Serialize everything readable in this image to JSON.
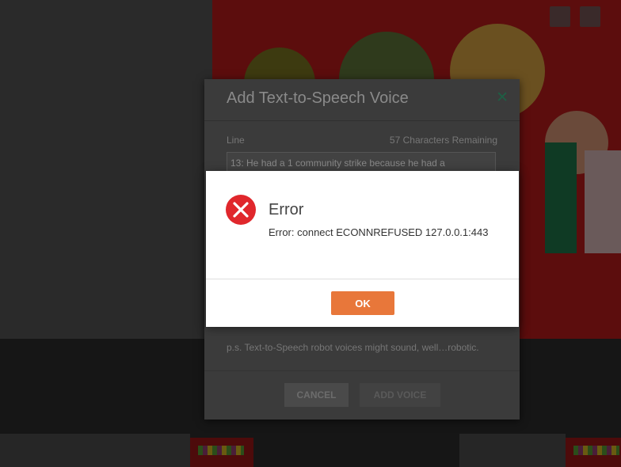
{
  "tts_dialog": {
    "title": "Add Text-to-Speech Voice",
    "close_icon": "close-icon",
    "line_label": "Line",
    "chars_remaining": "57 Characters Remaining",
    "line_value": "13: He had a 1 community strike because he had a",
    "ps_note": "p.s. Text-to-Speech robot voices might sound, well…robotic.",
    "cancel_label": "CANCEL",
    "add_label": "ADD VOICE"
  },
  "error_dialog": {
    "icon": "error-x-icon",
    "title": "Error",
    "message": "Error: connect ECONNREFUSED 127.0.0.1:443",
    "ok_label": "OK"
  },
  "colors": {
    "accent_orange": "#e8773a",
    "error_red": "#e0272c",
    "close_green": "#1f5e44"
  }
}
